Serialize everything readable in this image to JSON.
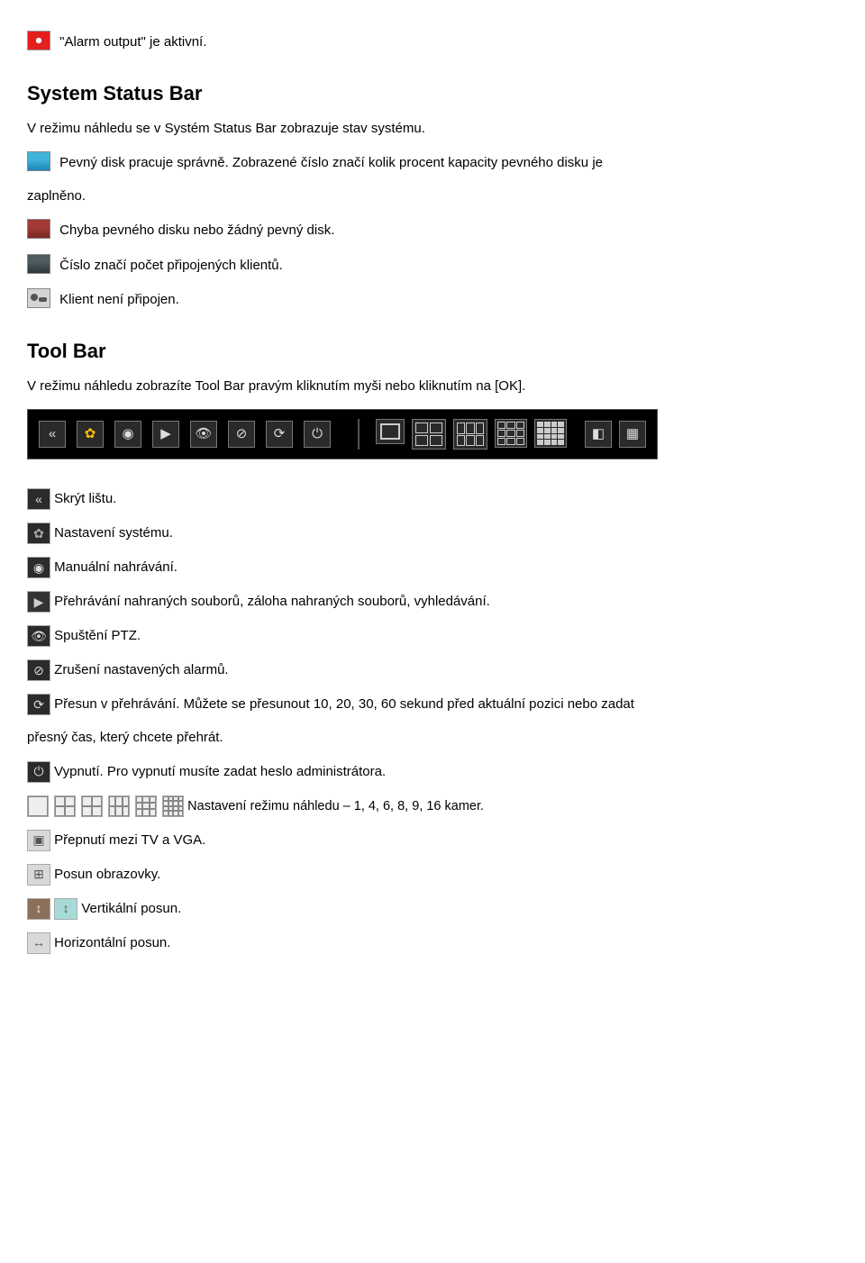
{
  "top": {
    "alarm": "\"Alarm output\" je aktivní."
  },
  "system_status_bar": {
    "heading": "System Status Bar",
    "intro": "V režimu náhledu se v Systém Status Bar zobrazuje stav systému.",
    "disk_ok": "Pevný disk pracuje správně. Zobrazené číslo značí kolik procent kapacity pevného disku je",
    "disk_ok_cont": "zaplněno.",
    "disk_err": "Chyba pevného disku nebo žádný pevný disk.",
    "clients": "Číslo značí počet připojených klientů.",
    "noclient": "Klient není připojen."
  },
  "tool_bar": {
    "heading": "Tool Bar",
    "intro": "V režimu náhledu zobrazíte Tool Bar pravým kliknutím myši nebo kliknutím na [OK].",
    "hide": "Skrýt lištu.",
    "settings": "Nastavení systému.",
    "record": "Manuální nahrávání.",
    "playback": "Přehrávání nahraných souborů, záloha nahraných souborů, vyhledávání.",
    "ptz": "Spuštění PTZ.",
    "alarm_cancel": "Zrušení nastavených alarmů.",
    "seek": "Přesun v přehrávání. Můžete se přesunout 10, 20, 30, 60 sekund před aktuální pozici nebo zadat",
    "seek_cont": "přesný čas, který chcete přehrát.",
    "shutdown": "Vypnutí. Pro vypnutí musíte zadat heslo administrátora.",
    "layouts": "Nastavení režimu náhledu – 1, 4, 6, 8, 9, 16 kamer.",
    "tv_vga": "Přepnutí mezi TV a VGA.",
    "screen_shift": "Posun obrazovky.",
    "vertical_shift": "Vertikální posun.",
    "horizontal_shift": "Horizontální posun."
  }
}
